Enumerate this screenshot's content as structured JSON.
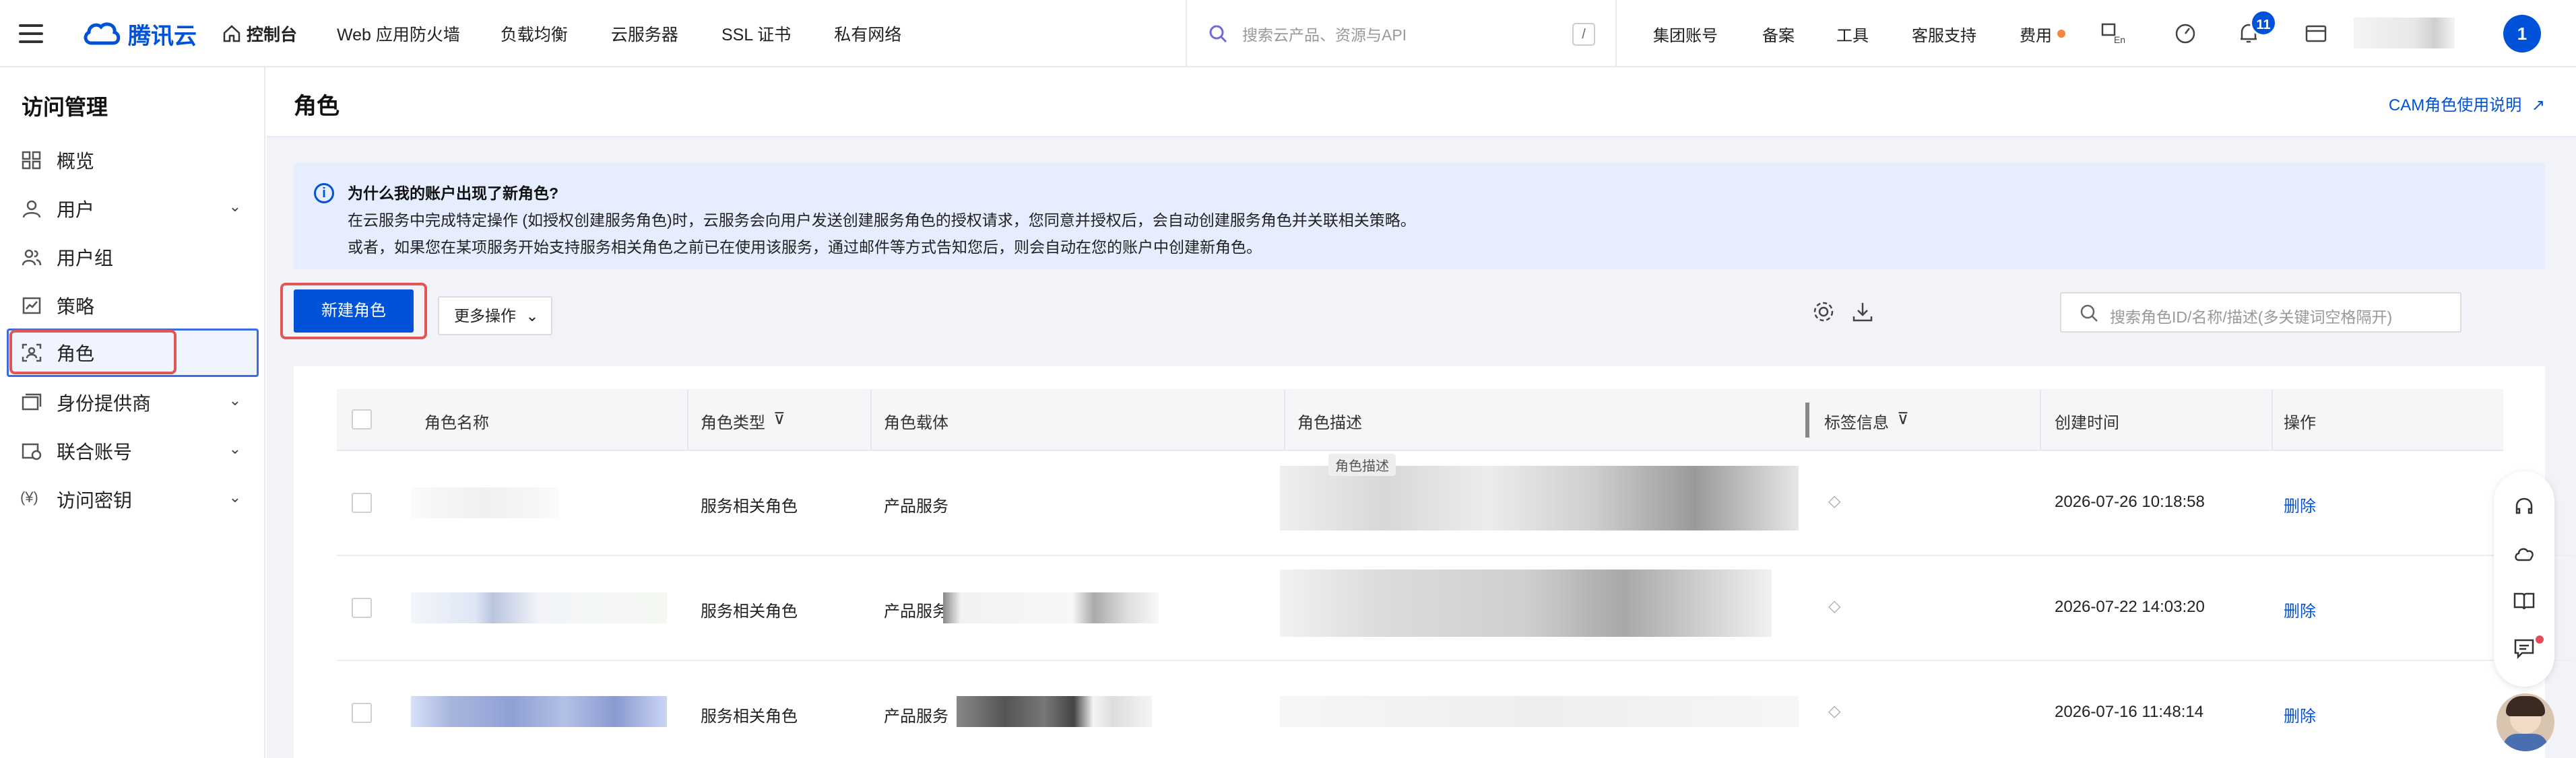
{
  "topbar": {
    "logo_text": "腾讯云",
    "console": "控制台",
    "nav": [
      "Web 应用防火墙",
      "负载均衡",
      "云服务器",
      "SSL 证书",
      "私有网络"
    ],
    "search_placeholder": "搜索云产品、资源与API",
    "search_shortcut": "/",
    "right_nav": [
      "集团账号",
      "备案",
      "工具",
      "客服支持",
      "费用"
    ],
    "notification_count": "11",
    "user_badge": "1"
  },
  "sidebar": {
    "title": "访问管理",
    "items": [
      {
        "label": "概览",
        "icon": "overview-icon",
        "expandable": false
      },
      {
        "label": "用户",
        "icon": "user-icon",
        "expandable": true
      },
      {
        "label": "用户组",
        "icon": "user-group-icon",
        "expandable": false
      },
      {
        "label": "策略",
        "icon": "policy-icon",
        "expandable": false
      },
      {
        "label": "角色",
        "icon": "role-icon",
        "expandable": false,
        "active": true
      },
      {
        "label": "身份提供商",
        "icon": "identity-provider-icon",
        "expandable": true
      },
      {
        "label": "联合账号",
        "icon": "federated-account-icon",
        "expandable": true
      },
      {
        "label": "访问密钥",
        "icon": "access-key-icon",
        "expandable": true
      }
    ]
  },
  "main": {
    "title": "角色",
    "doc_link": "CAM角色使用说明",
    "notice": {
      "title": "为什么我的账户出现了新角色?",
      "line1": "在云服务中完成特定操作 (如授权创建服务角色)时，云服务会向用户发送创建服务角色的授权请求，您同意并授权后，会自动创建服务角色并关联相关策略。",
      "line2": "或者，如果您在某项服务开始支持服务相关角色之前已在使用该服务，通过邮件等方式告知您后，则会自动在您的账户中创建新角色。"
    },
    "create_button": "新建角色",
    "more_button": "更多操作",
    "search_placeholder": "搜索角色ID/名称/描述(多关键词空格隔开)",
    "tooltip": "角色描述",
    "columns": [
      "角色名称",
      "角色类型",
      "角色载体",
      "角色描述",
      "标签信息",
      "创建时间",
      "操作"
    ],
    "rows": [
      {
        "type": "服务相关角色",
        "carrier": "产品服务",
        "created": "2026-07-26 10:18:58",
        "action": "删除"
      },
      {
        "type": "服务相关角色",
        "carrier": "产品服务",
        "created": "2026-07-22 14:03:20",
        "action": "删除"
      },
      {
        "type": "服务相关角色",
        "carrier": "产品服务",
        "created": "2026-07-16 11:48:14",
        "action": "删除"
      }
    ]
  },
  "colors": {
    "accent": "#0052d9",
    "highlight_border": "#e35555",
    "notice_bg": "#e6edfe"
  }
}
